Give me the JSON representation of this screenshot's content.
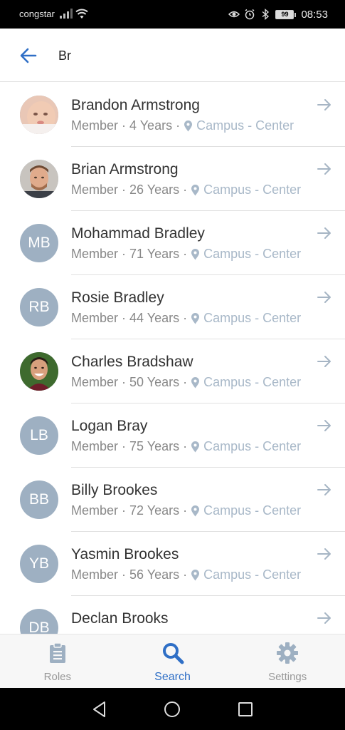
{
  "status_bar": {
    "carrier": "congstar",
    "battery": "99",
    "time": "08:53"
  },
  "search": {
    "query": "Br"
  },
  "colors": {
    "accent": "#2f6fc6",
    "avatar_bg": "#9eb0c2",
    "campus_text": "#a8b8c8",
    "tab_inactive": "#999999"
  },
  "results": [
    {
      "name": "Brandon Armstrong",
      "role": "Member",
      "age": "4 Years",
      "campus": "Campus - Center",
      "avatar_type": "photo",
      "avatar_photo": "baby-photo",
      "initials": ""
    },
    {
      "name": "Brian Armstrong",
      "role": "Member",
      "age": "26 Years",
      "campus": "Campus - Center",
      "avatar_type": "photo",
      "avatar_photo": "man-photo",
      "initials": ""
    },
    {
      "name": "Mohammad Bradley",
      "role": "Member",
      "age": "71 Years",
      "campus": "Campus - Center",
      "avatar_type": "initials",
      "initials": "MB"
    },
    {
      "name": "Rosie Bradley",
      "role": "Member",
      "age": "44 Years",
      "campus": "Campus - Center",
      "avatar_type": "initials",
      "initials": "RB"
    },
    {
      "name": "Charles Bradshaw",
      "role": "Member",
      "age": "50 Years",
      "campus": "Campus - Center",
      "avatar_type": "photo",
      "avatar_photo": "smiling-man-photo",
      "initials": ""
    },
    {
      "name": "Logan Bray",
      "role": "Member",
      "age": "75 Years",
      "campus": "Campus - Center",
      "avatar_type": "initials",
      "initials": "LB"
    },
    {
      "name": "Billy Brookes",
      "role": "Member",
      "age": "72 Years",
      "campus": "Campus - Center",
      "avatar_type": "initials",
      "initials": "BB"
    },
    {
      "name": "Yasmin Brookes",
      "role": "Member",
      "age": "56 Years",
      "campus": "Campus - Center",
      "avatar_type": "initials",
      "initials": "YB"
    },
    {
      "name": "Declan Brooks",
      "role": "",
      "age": "",
      "campus": "",
      "avatar_type": "initials",
      "initials": "DB"
    }
  ],
  "tabs": [
    {
      "label": "Roles",
      "icon": "clipboard-icon",
      "active": false
    },
    {
      "label": "Search",
      "icon": "search-icon",
      "active": true
    },
    {
      "label": "Settings",
      "icon": "gear-icon",
      "active": false
    }
  ]
}
